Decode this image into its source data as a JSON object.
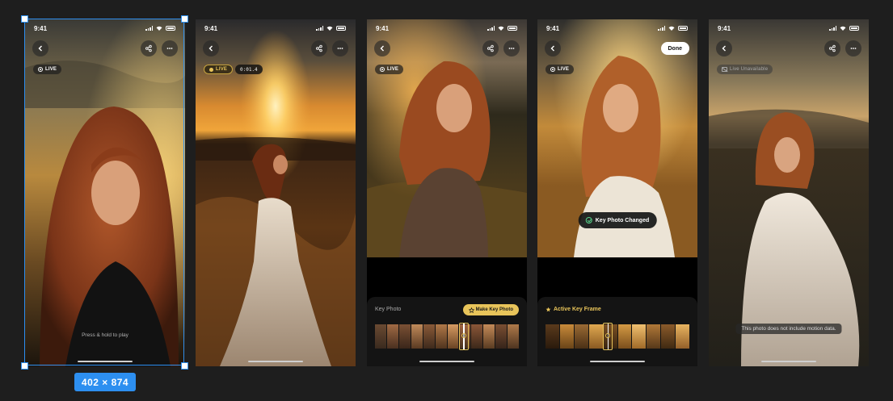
{
  "status_time": "9:41",
  "screens": [
    {
      "live_label": "LIVE",
      "hint": "Press & hold to play"
    },
    {
      "live_label": "LIVE",
      "timer": "0:01.4"
    },
    {
      "live_label": "LIVE",
      "panel_title": "Key Photo",
      "make_key_label": "Make Key Photo"
    },
    {
      "live_label": "LIVE",
      "done_label": "Done",
      "toast": "Key Photo Changed",
      "panel_title": "Active Key Frame"
    },
    {
      "live_label": "Live Unavailable",
      "note": "This photo does not include motion data."
    }
  ],
  "selection_size": "402 × 874",
  "colors": {
    "accent_gold": "#e8c45a",
    "selection_blue": "#2d8ff0",
    "canvas": "#1e1e1e",
    "success_green": "#58d68d"
  },
  "icons": [
    "chevron-left-icon",
    "share-icon",
    "ellipsis-icon",
    "live-icon",
    "star-icon",
    "check-circle-icon",
    "live-off-icon"
  ]
}
